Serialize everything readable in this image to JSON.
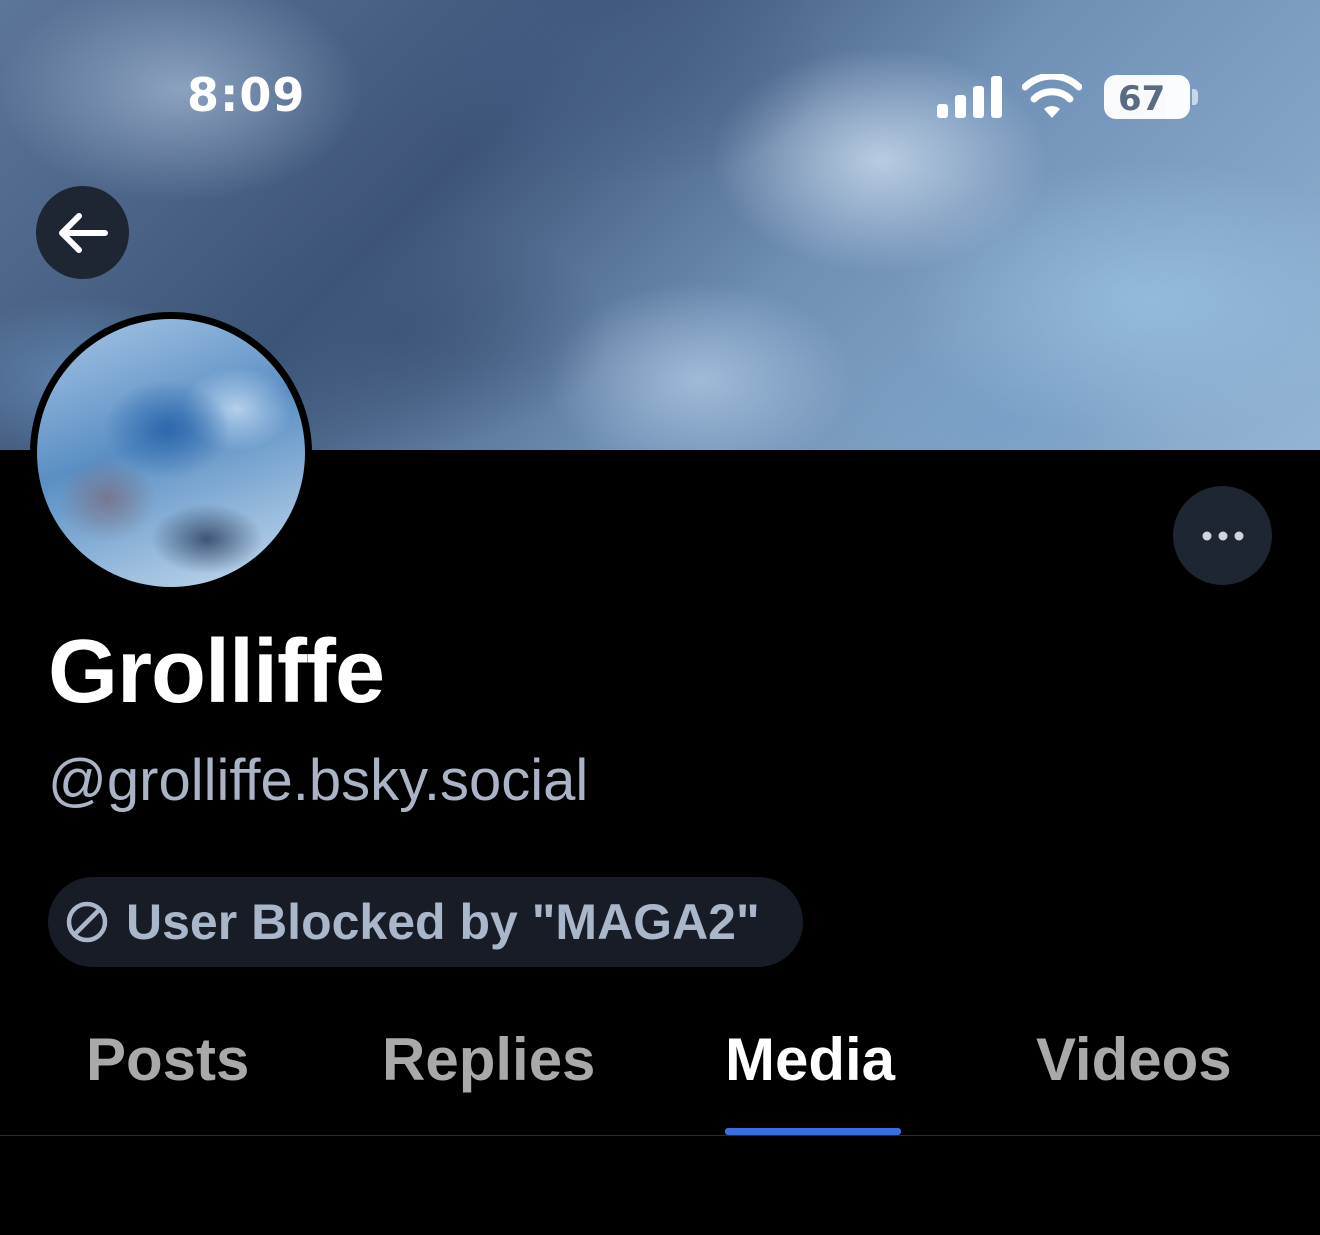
{
  "status_bar": {
    "time": "8:09",
    "battery_level": "67",
    "icons": [
      "cellular-signal-icon",
      "wifi-icon",
      "battery-icon"
    ]
  },
  "header": {
    "back_icon": "arrow-left-icon",
    "more_icon": "ellipsis-icon"
  },
  "profile": {
    "display_name": "Grolliffe",
    "handle": "@grolliffe.bsky.social",
    "moderation_label": "User Blocked by \"MAGA2\"",
    "moderation_icon": "circle-slash-icon"
  },
  "tabs": [
    {
      "label": "Posts",
      "active": false
    },
    {
      "label": "Replies",
      "active": false
    },
    {
      "label": "Media",
      "active": true
    },
    {
      "label": "Videos",
      "active": false
    }
  ],
  "colors": {
    "background": "#000000",
    "accent": "#3b6ee0",
    "muted_text": "#aab4c6",
    "pill_background": "#171c27",
    "button_background": "#1e2533"
  }
}
